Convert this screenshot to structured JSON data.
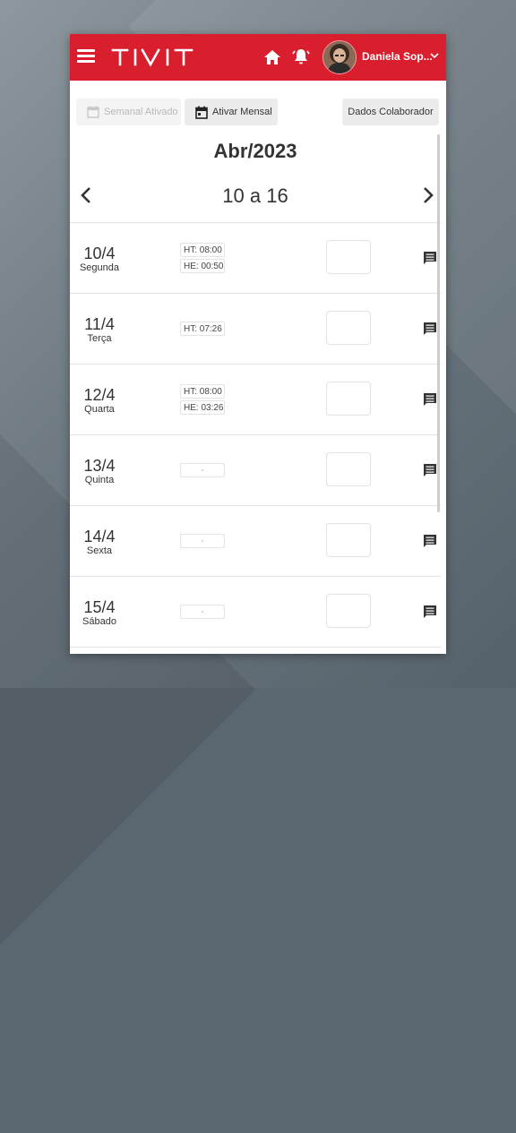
{
  "header": {
    "brand": "TIVIT",
    "user_name": "Daniela Sop...",
    "colors": {
      "bar": "#d91f2d"
    },
    "icons": [
      "menu-icon",
      "home-icon",
      "bell-icon",
      "chevron-down-icon"
    ]
  },
  "toolbar": {
    "weekly_label": "Semanal Ativado",
    "monthly_label": "Ativar Mensal",
    "employee_label": "Dados Colaborador"
  },
  "calendar": {
    "month": "Abr/2023",
    "week": "10 a 16",
    "days": [
      {
        "date": "10/4",
        "name": "Segunda",
        "hours": [
          "HT:  08:00",
          "HE:  00:50"
        ]
      },
      {
        "date": "11/4",
        "name": "Terça",
        "hours": [
          "HT:  07:26"
        ]
      },
      {
        "date": "12/4",
        "name": "Quarta",
        "hours": [
          "HT:  08:00",
          "HE:  03:26"
        ]
      },
      {
        "date": "13/4",
        "name": "Quinta",
        "hours": [
          "-"
        ]
      },
      {
        "date": "14/4",
        "name": "Sexta",
        "hours": [
          "-"
        ]
      },
      {
        "date": "15/4",
        "name": "Sábado",
        "hours": [
          "-"
        ]
      }
    ]
  }
}
